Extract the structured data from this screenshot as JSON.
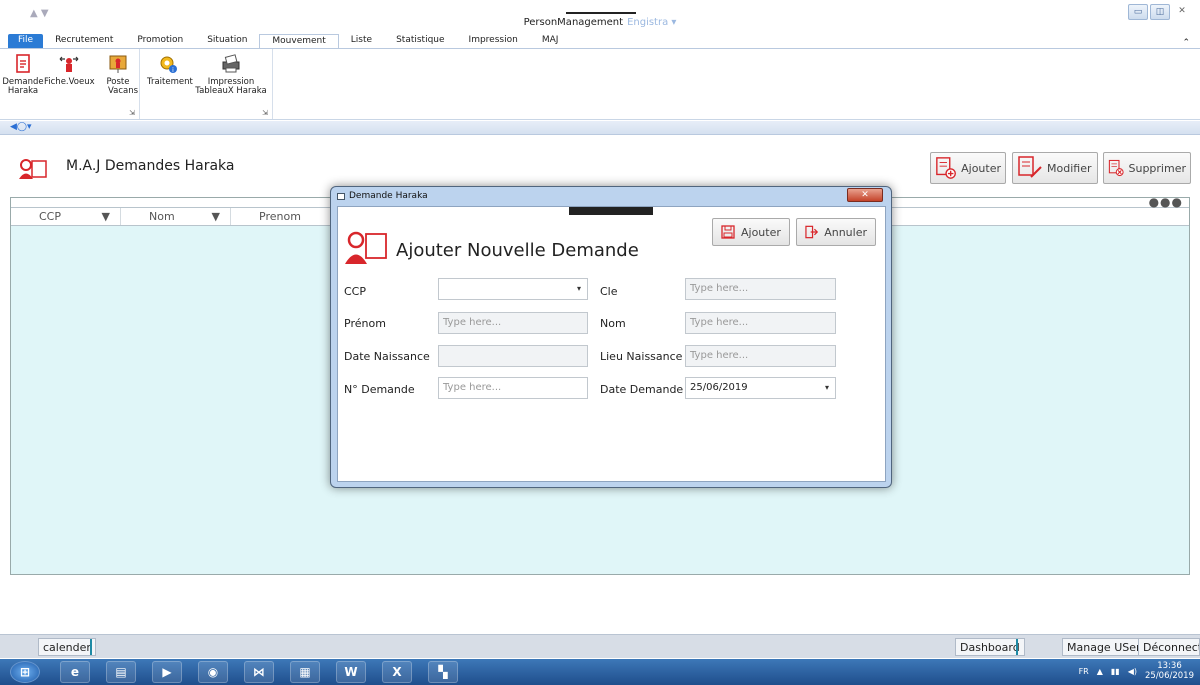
{
  "window": {
    "title": "PersonManagement",
    "subtitle": "Engistra ▾"
  },
  "ribbon": {
    "tabs": [
      "File",
      "Recrutement",
      "Promotion",
      "Situation",
      "Mouvement",
      "Liste",
      "Statistique",
      "Impression",
      "MAJ"
    ],
    "active_tab": "Mouvement",
    "group1": [
      {
        "l1": "Demande",
        "l2": "Haraka",
        "icon": "document-icon"
      },
      {
        "l1": "Fiche.Voeux",
        "l2": "",
        "icon": "person-arrows-icon"
      },
      {
        "l1": "Poste",
        "l2": "Vacans",
        "icon": "board-icon"
      }
    ],
    "group2": [
      {
        "l1": "Traitement",
        "l2": "",
        "icon": "gear-info-icon"
      },
      {
        "l1": "Impression",
        "l2": "TableauX Haraka",
        "icon": "printer-icon"
      }
    ]
  },
  "page": {
    "title": "M.A.J  Demandes Haraka",
    "buttons": {
      "add": "Ajouter",
      "edit": "Modifier",
      "delete": "Supprimer"
    },
    "grid_columns": [
      "CCP",
      "Nom",
      "Prenom"
    ]
  },
  "dialog": {
    "title": "Demande Haraka",
    "heading": "Ajouter Nouvelle Demande",
    "add_label": "Ajouter",
    "cancel_label": "Annuler",
    "fields": {
      "ccp": {
        "label": "CCP",
        "value": ""
      },
      "cle": {
        "label": "Cle",
        "placeholder": "Type here..."
      },
      "prenom": {
        "label": "Prénom",
        "placeholder": "Type here..."
      },
      "nom": {
        "label": "Nom",
        "placeholder": "Type here..."
      },
      "date_naissance": {
        "label": "Date Naissance",
        "value": ""
      },
      "lieu_naissance": {
        "label": "Lieu Naissance",
        "placeholder": "Type here..."
      },
      "num_demande": {
        "label": "N° Demande",
        "placeholder": "Type here..."
      },
      "date_demande": {
        "label": "Date Demande",
        "value": "25/06/2019"
      }
    }
  },
  "statusbar": {
    "left": "calender",
    "dashboard": "Dashboard",
    "manage": "Manage USers",
    "logout": "Déconnecter"
  },
  "taskbar": {
    "lang": "FR",
    "time": "13:36",
    "date": "25/06/2019"
  },
  "colors": {
    "accent": "#2b7bd5",
    "grid_bg": "#e0f6f8",
    "icon_red": "#d8262b"
  }
}
